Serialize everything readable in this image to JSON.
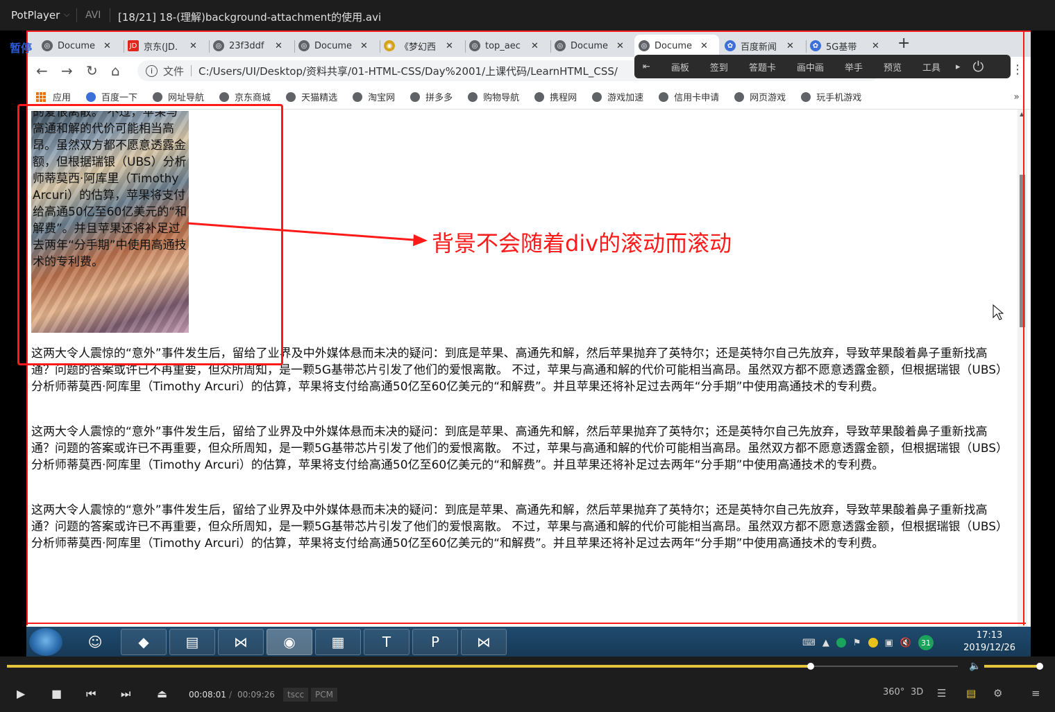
{
  "player": {
    "app_name": "PotPlayer",
    "format": "AVI",
    "file_title": "[18/21] 18-(理解)background-attachment的使用.avi",
    "pause_label": "暂停",
    "time_current": "00:08:01",
    "time_separator": "/",
    "time_total": "00:09:26",
    "codec_video": "tscc",
    "codec_audio": "PCM",
    "progress": 0.847,
    "volume": 0.95,
    "right_controls": [
      "360°",
      "3D"
    ],
    "accent_color": "#e3c43c"
  },
  "browser": {
    "tabs": [
      {
        "label": "Docume",
        "icon": "globe-icon"
      },
      {
        "label": "京东(JD.",
        "icon": "jd-icon"
      },
      {
        "label": "23f3ddf",
        "icon": "globe-icon"
      },
      {
        "label": "Docume",
        "icon": "globe-icon"
      },
      {
        "label": "《梦幻西",
        "icon": "game-icon"
      },
      {
        "label": "top_aec",
        "icon": "globe-icon"
      },
      {
        "label": "Docume",
        "icon": "globe-icon"
      },
      {
        "label": "Docume",
        "icon": "globe-icon",
        "active": true
      },
      {
        "label": "百度新闻",
        "icon": "baidu-icon"
      },
      {
        "label": "5G基带",
        "icon": "baidu-icon"
      }
    ],
    "new_tab": "+",
    "address": {
      "info_icon": "i",
      "scheme_label": "文件",
      "url": "C:/Users/UI/Desktop/资料共享/01-HTML-CSS/Day%2001/上课代码/LearnHTML_CSS/"
    },
    "ext_toolbar": [
      "画板",
      "签到",
      "答题卡",
      "画中画",
      "举手",
      "预览",
      "工具"
    ],
    "bookmarks": [
      "应用",
      "百度一下",
      "网址导航",
      "京东商城",
      "天猫精选",
      "淘宝网",
      "拼多多",
      "购物导航",
      "携程网",
      "游戏加速",
      "信用卡申请",
      "网页游戏",
      "玩手机游戏"
    ],
    "bookmarks_more": "»"
  },
  "page": {
    "scroll_box_text": "的爱恨离散。 不过，苹果与高通和解的代价可能相当高昂。虽然双方都不愿意透露金额，但根据瑞银（UBS）分析师蒂莫西·阿库里（Timothy Arcuri）的估算，苹果将支付给高通50亿至60亿美元的“和解费”。并且苹果还将补足过去两年“分手期”中使用高通技术的专利费。",
    "paragraphs": [
      "这两大令人震惊的“意外”事件发生后，留给了业界及中外媒体悬而未决的疑问：到底是苹果、高通先和解，然后苹果抛弃了英特尔；还是英特尔自己先放弃，导致苹果酸着鼻子重新找高通？问题的答案或许已不再重要，但众所周知，是一颗5G基带芯片引发了他们的爱恨离散。 不过，苹果与高通和解的代价可能相当高昂。虽然双方都不愿意透露金额，但根据瑞银（UBS）分析师蒂莫西·阿库里（Timothy Arcuri）的估算，苹果将支付给高通50亿至60亿美元的“和解费”。并且苹果还将补足过去两年“分手期”中使用高通技术的专利费。",
      "这两大令人震惊的“意外”事件发生后，留给了业界及中外媒体悬而未决的疑问：到底是苹果、高通先和解，然后苹果抛弃了英特尔；还是英特尔自己先放弃，导致苹果酸着鼻子重新找高通？问题的答案或许已不再重要，但众所周知，是一颗5G基带芯片引发了他们的爱恨离散。 不过，苹果与高通和解的代价可能相当高昂。虽然双方都不愿意透露金额，但根据瑞银（UBS）分析师蒂莫西·阿库里（Timothy Arcuri）的估算，苹果将支付给高通50亿至60亿美元的“和解费”。并且苹果还将补足过去两年“分手期”中使用高通技术的专利费。",
      "这两大令人震惊的“意外”事件发生后，留给了业界及中外媒体悬而未决的疑问：到底是苹果、高通先和解，然后苹果抛弃了英特尔；还是英特尔自己先放弃，导致苹果酸着鼻子重新找高通？问题的答案或许已不再重要，但众所周知，是一颗5G基带芯片引发了他们的爱恨离散。 不过，苹果与高通和解的代价可能相当高昂。虽然双方都不愿意透露金额，但根据瑞银（UBS）分析师蒂莫西·阿库里（Timothy Arcuri）的估算，苹果将支付给高通50亿至60亿美元的“和解费”。并且苹果还将补足过去两年“分手期”中使用高通技术的专利费。"
    ],
    "annotation": "背景不会随着div的滚动而滚动",
    "annotation_color": "#ff1a1a"
  },
  "taskbar": {
    "apps": [
      "qq-avatar",
      "app-icon",
      "file-explorer",
      "vscode",
      "chrome",
      "notes",
      "typora",
      "powerpoint",
      "vscode"
    ],
    "tray_badge": "31",
    "clock_time": "17:13",
    "clock_date": "2019/12/26"
  }
}
